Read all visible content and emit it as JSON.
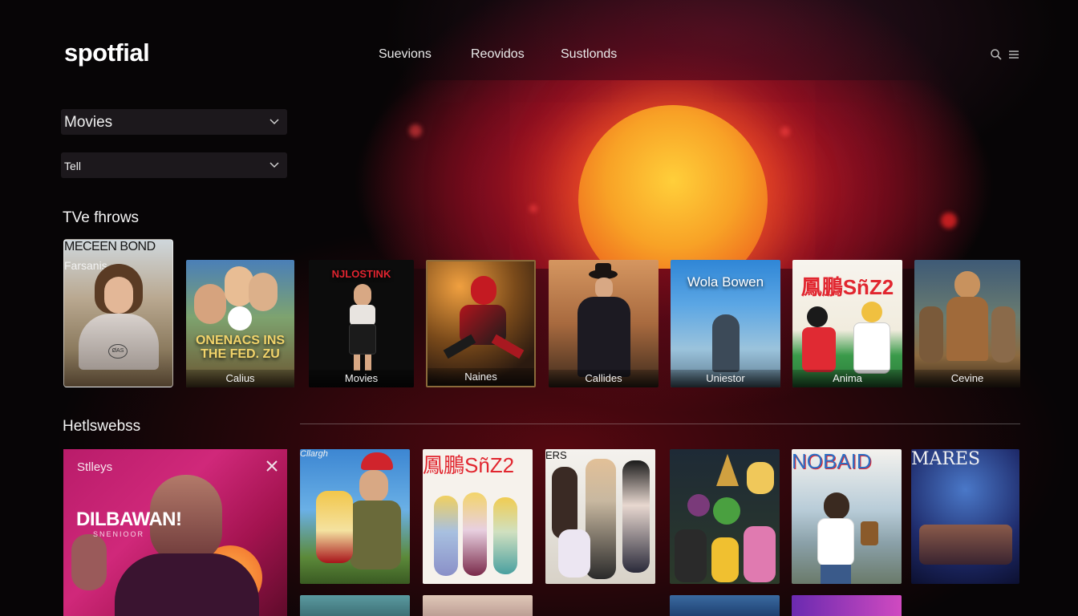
{
  "app": {
    "name": "spotfial"
  },
  "nav": {
    "items": [
      "Suevions",
      "Reovidos",
      "Sustlonds"
    ]
  },
  "icons": {
    "search": "search-icon",
    "menu": "menu-icon",
    "chevron": "chevron-down-icon",
    "close": "close-icon"
  },
  "filters": {
    "primary": {
      "value": "Movies"
    },
    "secondary": {
      "value": "Tell"
    }
  },
  "sections": {
    "row1_title": "TVe fhrows",
    "row2_title": "Hetlswebss"
  },
  "row1": {
    "featured": {
      "poster_text": "MECEEN BOND",
      "caption": "Farsanis",
      "badge": "ØAS"
    },
    "cards": [
      {
        "caption": "Calius",
        "poster_text": "ONENACS INS THE FED. ZU"
      },
      {
        "caption": "Movies",
        "poster_text": "NJLOSTINK"
      },
      {
        "caption": "Naines",
        "poster_text": ""
      },
      {
        "caption": "Callides",
        "poster_text": ""
      },
      {
        "caption": "Uniestor",
        "poster_text": "Wola Bowen"
      },
      {
        "caption": "Anima",
        "poster_text": "鳳鵬SñZ2"
      },
      {
        "caption": "Cevine",
        "poster_text": ""
      }
    ]
  },
  "row2": {
    "promo": {
      "kicker": "Stlleys",
      "title": "DILBAWAN!",
      "subtitle": "SNENIOOR"
    },
    "cards": [
      {
        "poster_text": "Cllargh"
      },
      {
        "poster_text": "鳳鵬SñZ2"
      },
      {
        "poster_text": "ERS"
      },
      {
        "poster_text": ""
      },
      {
        "poster_text": "NOBAID"
      },
      {
        "poster_text": "MARES"
      }
    ]
  },
  "colors": {
    "accent": "#d7142a",
    "sun": "#f8a226",
    "background": "#070506"
  }
}
